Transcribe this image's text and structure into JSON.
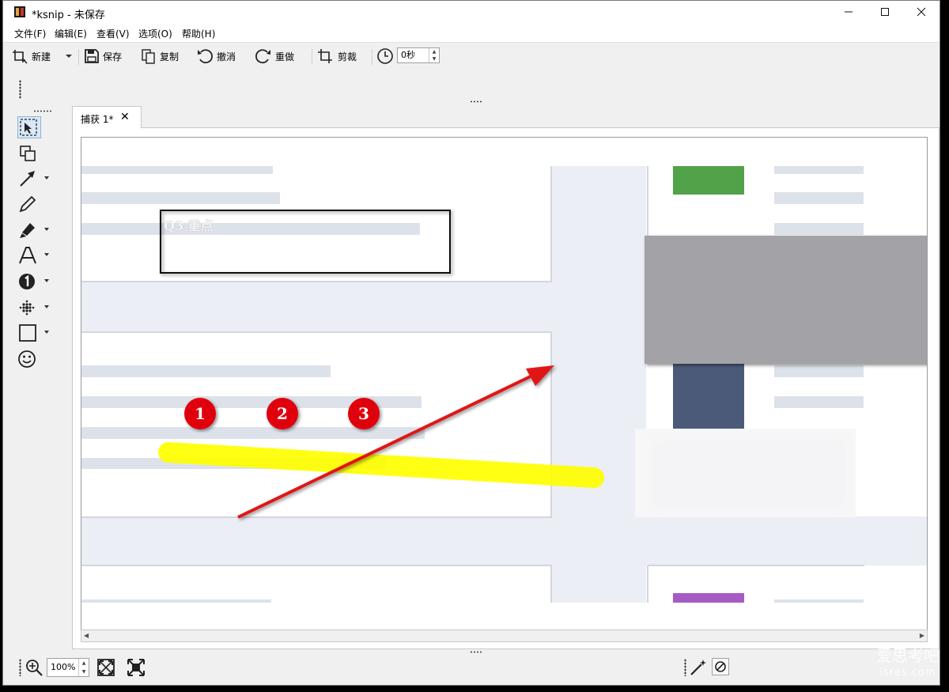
{
  "window": {
    "title": "*ksnip - 未保存"
  },
  "menu": [
    "文件(F)",
    "编辑(E)",
    "查看(V)",
    "选项(O)",
    "帮助(H)"
  ],
  "toolbar": {
    "new": "新建",
    "save": "保存",
    "copy": "复制",
    "undo": "撤消",
    "redo": "重做",
    "crop": "剪裁",
    "delay_value": "0秒"
  },
  "tab": {
    "label": "捕获 1*"
  },
  "canvas": {
    "text_annotation": "Q3 重点",
    "badges": [
      "1",
      "2",
      "3"
    ],
    "colors": {
      "highlighter": "#ffff00",
      "arrow": "#e01414",
      "badge": "#e00010",
      "block_green": "#52a24a",
      "block_navy": "#4b5a78",
      "block_purple": "#a45bc4",
      "obfuscate_gray": "#a3a2a6"
    }
  },
  "statusbar": {
    "zoom": "100%"
  },
  "watermark": {
    "line1": "爱思考吧",
    "line2": "isres.com"
  },
  "icons": [
    "new-capture-icon",
    "save-icon",
    "copy-icon",
    "undo-icon",
    "redo-icon",
    "crop-icon",
    "clock-icon",
    "select-tool-icon",
    "duplicate-tool-icon",
    "arrow-tool-icon",
    "pen-tool-icon",
    "marker-tool-icon",
    "text-tool-icon",
    "number-tool-icon",
    "blur-tool-icon",
    "rect-tool-icon",
    "sticker-tool-icon",
    "zoom-icon",
    "fit-icon",
    "fullscreen-icon",
    "magic-wand-icon",
    "no-effect-icon"
  ]
}
